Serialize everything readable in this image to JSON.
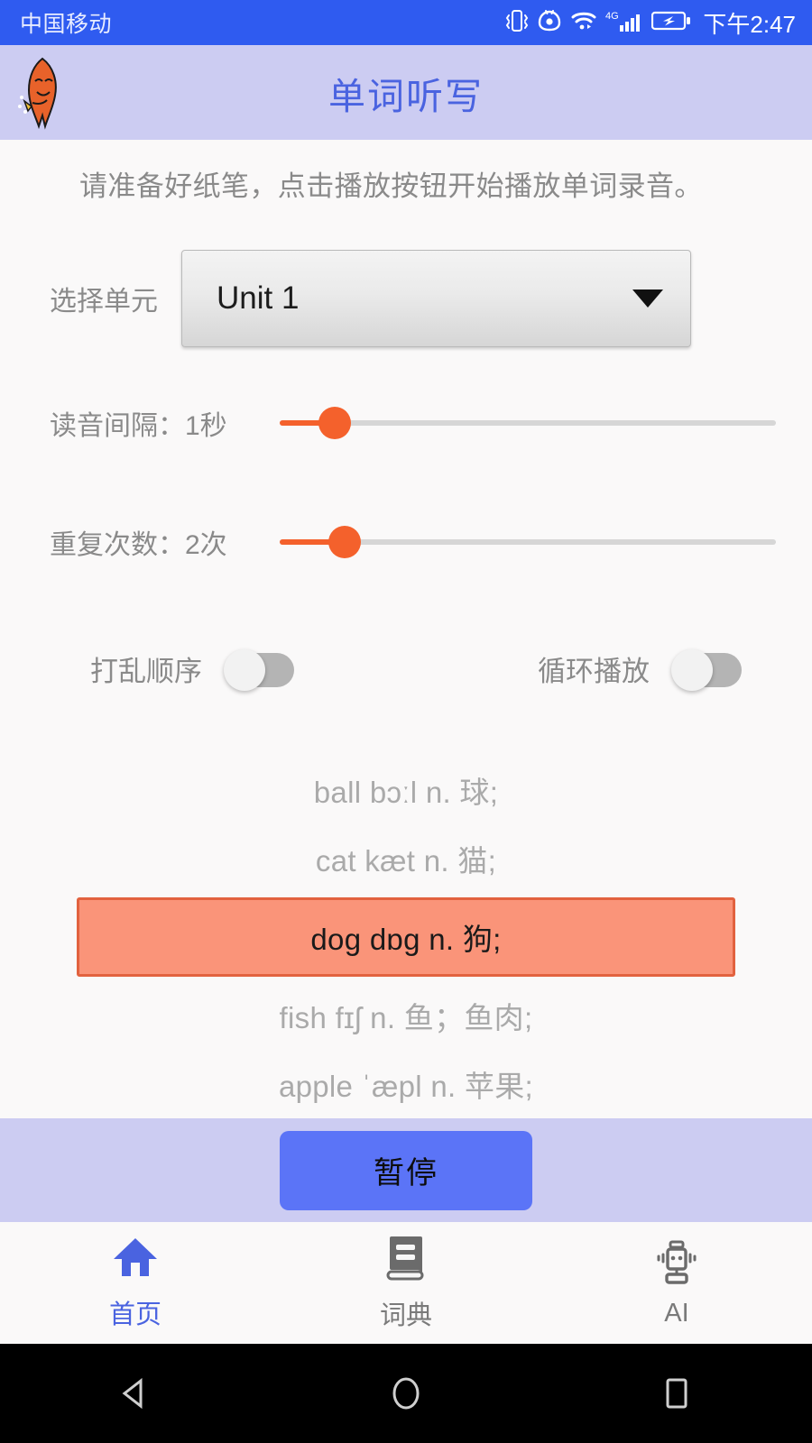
{
  "status_bar": {
    "carrier": "中国移动",
    "time": "下午2:47",
    "icons": [
      "vibrate-icon",
      "eye-care-icon",
      "wifi-icon",
      "4g-signal-icon",
      "battery-charging-icon"
    ],
    "network_label": "4G",
    "background_color": "#2f5bf0"
  },
  "header": {
    "title": "单词听写",
    "logo": "rocket-mascot-icon",
    "background_color": "#ccccf2",
    "title_color": "#4a63e0"
  },
  "main": {
    "instruction": "请准备好纸笔，点击播放按钮开始播放单词录音。",
    "unit_select": {
      "label": "选择单元",
      "value": "Unit 1",
      "caret": "chevron-down-icon"
    },
    "sliders": [
      {
        "label": "读音间隔：1秒",
        "value": 1,
        "unit": "秒",
        "percent": 11,
        "accent_color": "#f4612c"
      },
      {
        "label": "重复次数：2次",
        "value": 2,
        "unit": "次",
        "percent": 13,
        "accent_color": "#f4612c"
      }
    ],
    "toggles": [
      {
        "label": "打乱顺序",
        "state": "off"
      },
      {
        "label": "循环播放",
        "state": "off"
      }
    ],
    "word_list": [
      {
        "text": "ball bɔːl n. 球;",
        "current": false
      },
      {
        "text": "cat kæt n. 猫;",
        "current": false
      },
      {
        "text": "dog dɒg n. 狗;",
        "current": true
      },
      {
        "text": "fish fɪʃ n. 鱼；鱼肉;",
        "current": false
      },
      {
        "text": "apple ˈæpl n. 苹果;",
        "current": false
      }
    ],
    "highlight_color": "#fa9479",
    "highlight_border_color": "#e2623f"
  },
  "play_bar": {
    "button_label": "暂停",
    "button_color": "#5b74f7",
    "background_color": "#ccccf2"
  },
  "bottom_nav": {
    "items": [
      {
        "label": "首页",
        "icon": "home-icon",
        "active": true
      },
      {
        "label": "词典",
        "icon": "dictionary-book-icon",
        "active": false
      },
      {
        "label": "AI",
        "icon": "robot-icon",
        "active": false
      }
    ],
    "active_color": "#4a63e0",
    "inactive_color": "#7a7a7a"
  },
  "android_nav": {
    "keys": [
      "back-icon",
      "home-circle-icon",
      "recents-square-icon"
    ]
  }
}
